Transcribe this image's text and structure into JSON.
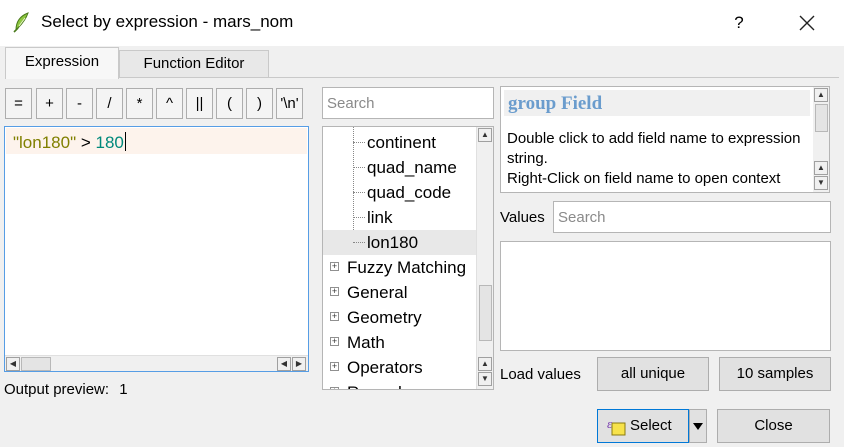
{
  "window": {
    "title": "Select by expression - mars_nom",
    "help_glyph": "?",
    "close_icon": "close-icon"
  },
  "tabs": [
    {
      "label": "Expression",
      "active": true
    },
    {
      "label": "Function Editor",
      "active": false
    }
  ],
  "operators": [
    "=",
    "+",
    "-",
    "/",
    "*",
    "^",
    "||",
    "(",
    ")",
    "'\\n'"
  ],
  "editor": {
    "tokens": [
      {
        "text": "\"lon180\"",
        "kind": "string"
      },
      {
        "text": " > ",
        "kind": "operator"
      },
      {
        "text": "180",
        "kind": "number"
      }
    ]
  },
  "output_preview": {
    "label": "Output preview:",
    "value": "1"
  },
  "function_tree": {
    "search_placeholder": "Search",
    "fields": [
      "continent",
      "quad_name",
      "quad_code",
      "link",
      "lon180"
    ],
    "selected_field": "lon180",
    "groups": [
      "Fuzzy Matching",
      "General",
      "Geometry",
      "Math",
      "Operators",
      "Record"
    ]
  },
  "help": {
    "title": "group Field",
    "text": "Double click to add field name to expression string.\nRight-Click on field name to open context menu sample value loading options."
  },
  "values": {
    "label": "Values",
    "search_placeholder": "Search",
    "items": []
  },
  "load_values": {
    "label": "Load values",
    "all_unique": "all unique",
    "ten_samples": "10 samples"
  },
  "footer": {
    "select": "Select",
    "close": "Close"
  },
  "colors": {
    "accent": "#0078d7",
    "help_title": "#6a9ccd",
    "string_token": "#808000",
    "number_token": "#00897b"
  }
}
